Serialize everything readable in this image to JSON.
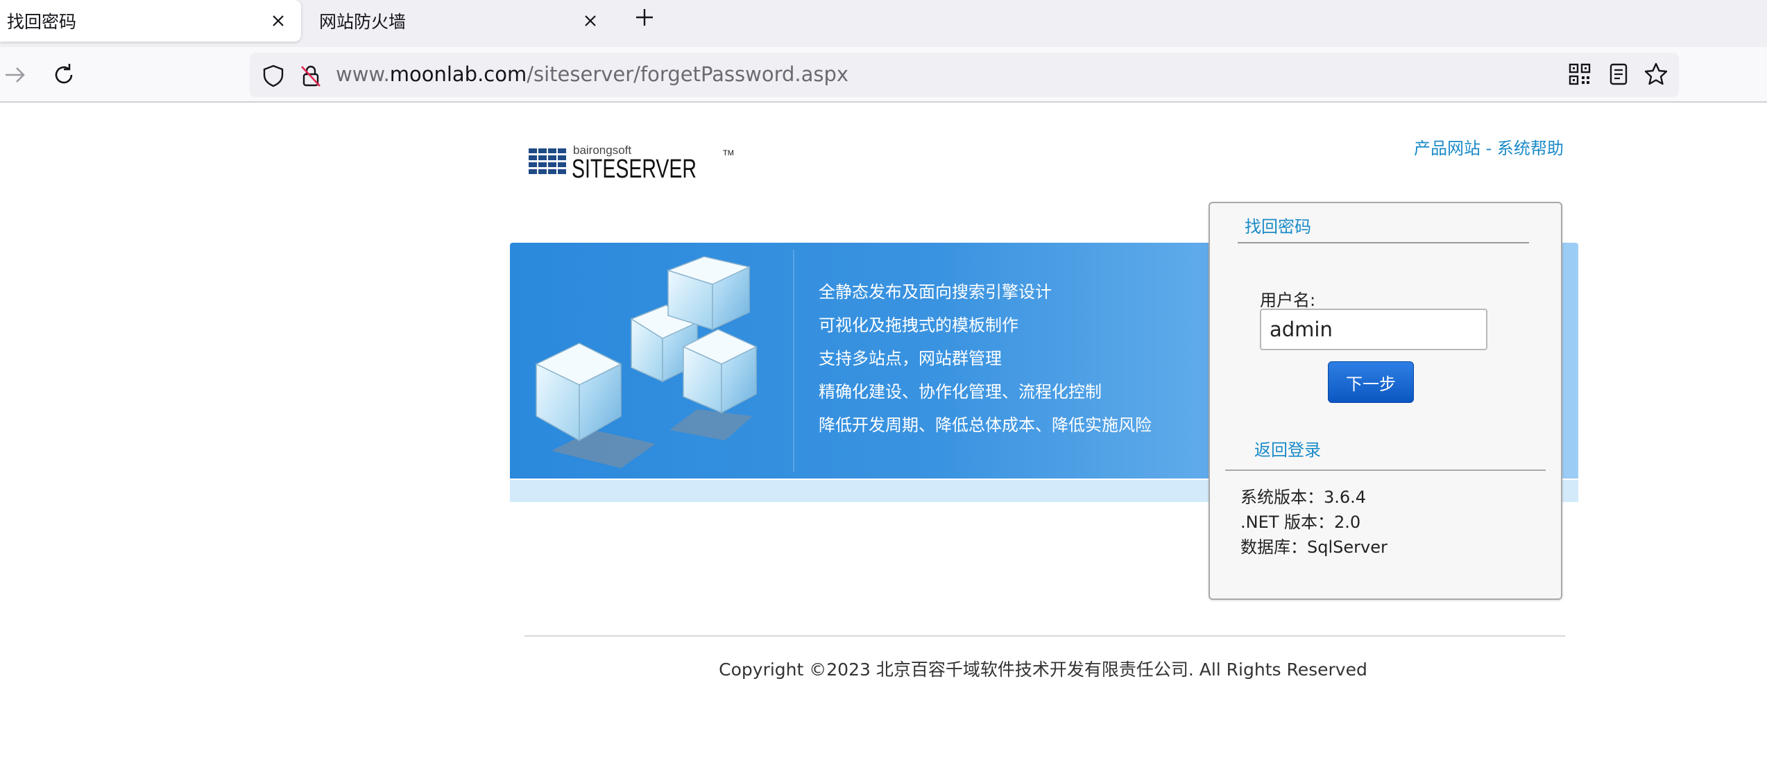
{
  "browser": {
    "tabs": [
      {
        "title": "找回密码",
        "active": true
      },
      {
        "title": "网站防火墙",
        "active": false
      }
    ],
    "url": {
      "prefix": "www.",
      "host": "moonlab.com",
      "path": "/siteserver/forgetPassword.aspx"
    }
  },
  "page": {
    "logo": {
      "brand_small": "bairongsoft",
      "brand": "SITESERVER",
      "tm": "TM"
    },
    "top_links": {
      "product_site": "产品网站",
      "separator": " - ",
      "help": "系统帮助"
    },
    "features": [
      "全静态发布及面向搜索引擎设计",
      "可视化及拖拽式的模板制作",
      "支持多站点，网站群管理",
      "精确化建设、协作化管理、流程化控制",
      "降低开发周期、降低总体成本、降低实施风险"
    ],
    "panel": {
      "title": "找回密码",
      "username_label": "用户名:",
      "username_value": "admin",
      "next_button": "下一步",
      "back_link": "返回登录",
      "sysinfo": {
        "version": "系统版本：3.6.4",
        "dotnet": ".NET 版本：2.0",
        "database": "数据库：SqlServer"
      }
    },
    "footer": "Copyright ©2023 北京百容千域软件技术开发有限责任公司. All Rights Reserved"
  },
  "colors": {
    "link": "#1a8bc8",
    "button": "#0c57c2",
    "banner": "#2b89dc"
  }
}
